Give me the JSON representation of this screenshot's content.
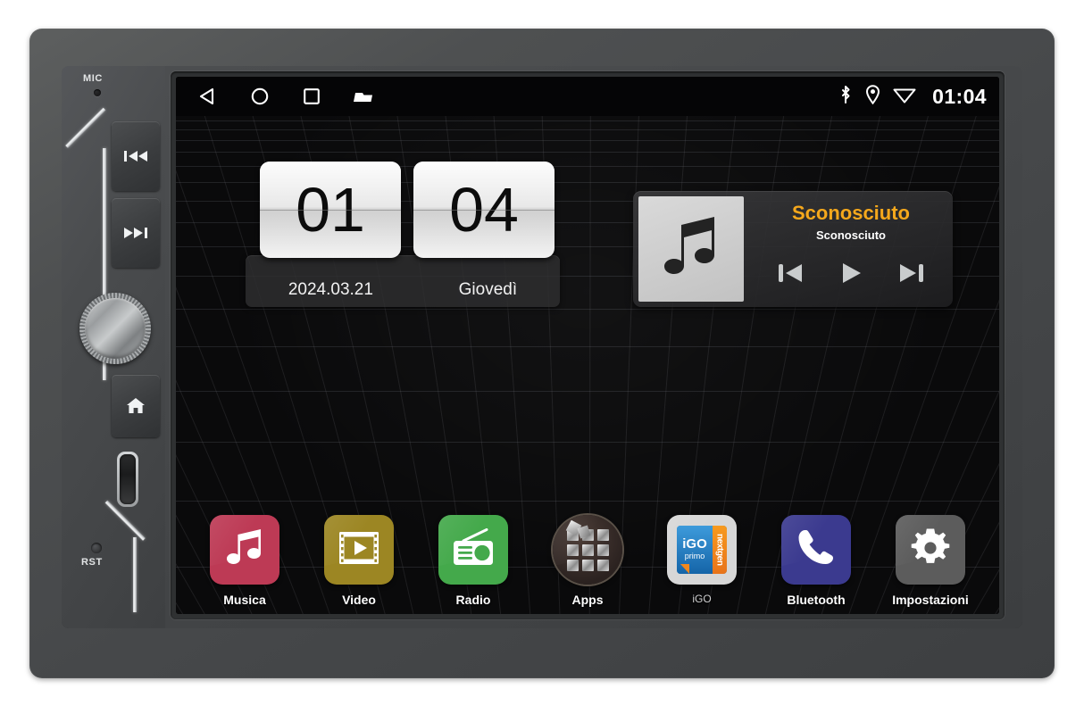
{
  "device": {
    "name": "double-din-car-head-unit",
    "side_panel": {
      "mic_label": "MIC",
      "reset_label": "RST",
      "buttons": [
        {
          "name": "previous-track",
          "icon": "skip-backward-icon"
        },
        {
          "name": "next-track",
          "icon": "skip-forward-icon"
        },
        {
          "name": "home",
          "icon": "home-icon"
        }
      ],
      "knob": {
        "name": "volume-knob",
        "icon": "rotary-knob-icon"
      },
      "card_slot": {
        "name": "sd-card-slot",
        "icon": "sd-card-slot-icon"
      }
    }
  },
  "screen": {
    "statusbar": {
      "nav": [
        {
          "name": "back",
          "label": "back-icon"
        },
        {
          "name": "home",
          "label": "circle-home-icon"
        },
        {
          "name": "recents",
          "label": "square-recents-icon"
        },
        {
          "name": "files",
          "label": "folder-icon"
        }
      ],
      "icons": [
        {
          "name": "bluetooth",
          "label": "bluetooth-icon"
        },
        {
          "name": "location",
          "label": "location-pin-icon"
        },
        {
          "name": "wifi",
          "label": "wifi-icon"
        }
      ],
      "time": "01:04"
    },
    "clock_widget": {
      "hour": "01",
      "minute": "04",
      "date": "2024.03.21",
      "weekday": "Giovedì"
    },
    "music_widget": {
      "album_art_icon": "music-note-icon",
      "title": "Sconosciuto",
      "artist": "Sconosciuto",
      "title_color": "#f5a81c",
      "controls": [
        {
          "name": "previous",
          "label": "previous-track-icon"
        },
        {
          "name": "play",
          "label": "play-icon"
        },
        {
          "name": "next",
          "label": "next-track-icon"
        }
      ]
    },
    "dock": [
      {
        "label": "Musica",
        "icon": "music-note-icon",
        "color": "#bd3a55",
        "shape": "rounded"
      },
      {
        "label": "Video",
        "icon": "film-play-icon",
        "color": "#9c8623",
        "shape": "rounded"
      },
      {
        "label": "Radio",
        "icon": "radio-icon",
        "color": "#44a94b",
        "shape": "rounded"
      },
      {
        "label": "Apps",
        "icon": "app-grid-icon",
        "color": "#3a2f2b",
        "shape": "round"
      },
      {
        "label": "iGO",
        "icon": "igo-primo-icon",
        "color": "#d7d7d7",
        "shape": "rounded"
      },
      {
        "label": "Bluetooth",
        "icon": "phone-handset-icon",
        "color": "#3b3a8f",
        "shape": "rounded"
      },
      {
        "label": "Impostazioni",
        "icon": "gear-icon",
        "color": "#5c5c5c",
        "shape": "rounded"
      }
    ],
    "igo_logo": {
      "primary": "iGO",
      "secondary": "primo",
      "accent": "nextgen"
    }
  }
}
